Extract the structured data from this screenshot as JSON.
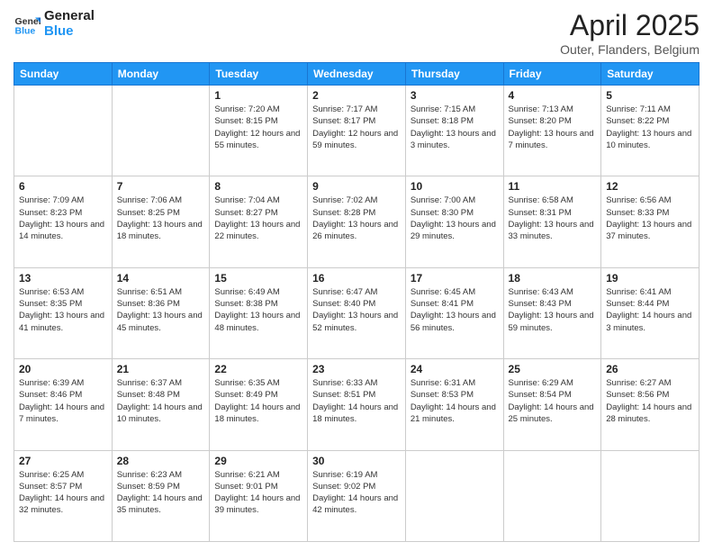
{
  "header": {
    "logo_line1": "General",
    "logo_line2": "Blue",
    "month": "April 2025",
    "location": "Outer, Flanders, Belgium"
  },
  "weekdays": [
    "Sunday",
    "Monday",
    "Tuesday",
    "Wednesday",
    "Thursday",
    "Friday",
    "Saturday"
  ],
  "weeks": [
    [
      {
        "day": "",
        "info": ""
      },
      {
        "day": "",
        "info": ""
      },
      {
        "day": "1",
        "info": "Sunrise: 7:20 AM\nSunset: 8:15 PM\nDaylight: 12 hours and 55 minutes."
      },
      {
        "day": "2",
        "info": "Sunrise: 7:17 AM\nSunset: 8:17 PM\nDaylight: 12 hours and 59 minutes."
      },
      {
        "day": "3",
        "info": "Sunrise: 7:15 AM\nSunset: 8:18 PM\nDaylight: 13 hours and 3 minutes."
      },
      {
        "day": "4",
        "info": "Sunrise: 7:13 AM\nSunset: 8:20 PM\nDaylight: 13 hours and 7 minutes."
      },
      {
        "day": "5",
        "info": "Sunrise: 7:11 AM\nSunset: 8:22 PM\nDaylight: 13 hours and 10 minutes."
      }
    ],
    [
      {
        "day": "6",
        "info": "Sunrise: 7:09 AM\nSunset: 8:23 PM\nDaylight: 13 hours and 14 minutes."
      },
      {
        "day": "7",
        "info": "Sunrise: 7:06 AM\nSunset: 8:25 PM\nDaylight: 13 hours and 18 minutes."
      },
      {
        "day": "8",
        "info": "Sunrise: 7:04 AM\nSunset: 8:27 PM\nDaylight: 13 hours and 22 minutes."
      },
      {
        "day": "9",
        "info": "Sunrise: 7:02 AM\nSunset: 8:28 PM\nDaylight: 13 hours and 26 minutes."
      },
      {
        "day": "10",
        "info": "Sunrise: 7:00 AM\nSunset: 8:30 PM\nDaylight: 13 hours and 29 minutes."
      },
      {
        "day": "11",
        "info": "Sunrise: 6:58 AM\nSunset: 8:31 PM\nDaylight: 13 hours and 33 minutes."
      },
      {
        "day": "12",
        "info": "Sunrise: 6:56 AM\nSunset: 8:33 PM\nDaylight: 13 hours and 37 minutes."
      }
    ],
    [
      {
        "day": "13",
        "info": "Sunrise: 6:53 AM\nSunset: 8:35 PM\nDaylight: 13 hours and 41 minutes."
      },
      {
        "day": "14",
        "info": "Sunrise: 6:51 AM\nSunset: 8:36 PM\nDaylight: 13 hours and 45 minutes."
      },
      {
        "day": "15",
        "info": "Sunrise: 6:49 AM\nSunset: 8:38 PM\nDaylight: 13 hours and 48 minutes."
      },
      {
        "day": "16",
        "info": "Sunrise: 6:47 AM\nSunset: 8:40 PM\nDaylight: 13 hours and 52 minutes."
      },
      {
        "day": "17",
        "info": "Sunrise: 6:45 AM\nSunset: 8:41 PM\nDaylight: 13 hours and 56 minutes."
      },
      {
        "day": "18",
        "info": "Sunrise: 6:43 AM\nSunset: 8:43 PM\nDaylight: 13 hours and 59 minutes."
      },
      {
        "day": "19",
        "info": "Sunrise: 6:41 AM\nSunset: 8:44 PM\nDaylight: 14 hours and 3 minutes."
      }
    ],
    [
      {
        "day": "20",
        "info": "Sunrise: 6:39 AM\nSunset: 8:46 PM\nDaylight: 14 hours and 7 minutes."
      },
      {
        "day": "21",
        "info": "Sunrise: 6:37 AM\nSunset: 8:48 PM\nDaylight: 14 hours and 10 minutes."
      },
      {
        "day": "22",
        "info": "Sunrise: 6:35 AM\nSunset: 8:49 PM\nDaylight: 14 hours and 18 minutes."
      },
      {
        "day": "23",
        "info": "Sunrise: 6:33 AM\nSunset: 8:51 PM\nDaylight: 14 hours and 18 minutes."
      },
      {
        "day": "24",
        "info": "Sunrise: 6:31 AM\nSunset: 8:53 PM\nDaylight: 14 hours and 21 minutes."
      },
      {
        "day": "25",
        "info": "Sunrise: 6:29 AM\nSunset: 8:54 PM\nDaylight: 14 hours and 25 minutes."
      },
      {
        "day": "26",
        "info": "Sunrise: 6:27 AM\nSunset: 8:56 PM\nDaylight: 14 hours and 28 minutes."
      }
    ],
    [
      {
        "day": "27",
        "info": "Sunrise: 6:25 AM\nSunset: 8:57 PM\nDaylight: 14 hours and 32 minutes."
      },
      {
        "day": "28",
        "info": "Sunrise: 6:23 AM\nSunset: 8:59 PM\nDaylight: 14 hours and 35 minutes."
      },
      {
        "day": "29",
        "info": "Sunrise: 6:21 AM\nSunset: 9:01 PM\nDaylight: 14 hours and 39 minutes."
      },
      {
        "day": "30",
        "info": "Sunrise: 6:19 AM\nSunset: 9:02 PM\nDaylight: 14 hours and 42 minutes."
      },
      {
        "day": "",
        "info": ""
      },
      {
        "day": "",
        "info": ""
      },
      {
        "day": "",
        "info": ""
      }
    ]
  ]
}
